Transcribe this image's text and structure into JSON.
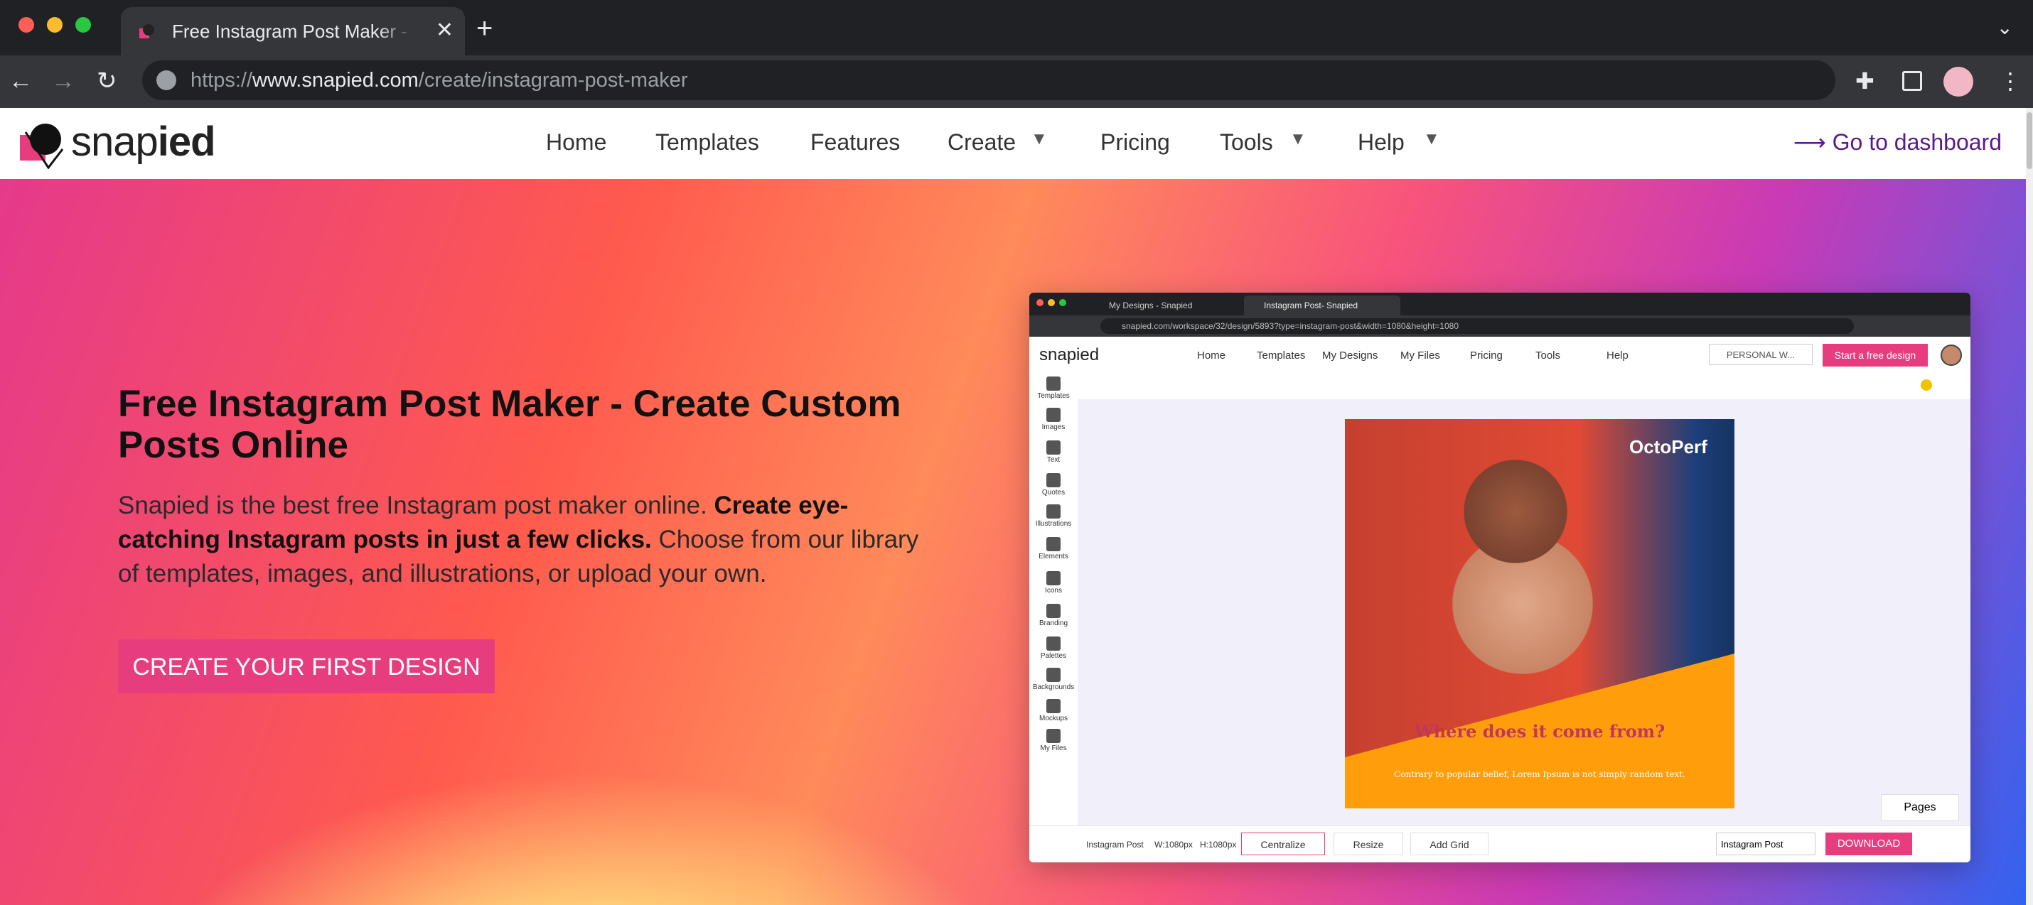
{
  "browser": {
    "tab_title": "Free Instagram Post Maker - Create Custom Posts Online",
    "close_glyph": "✕",
    "new_tab_glyph": "+",
    "url_scheme": "https://",
    "url_host": "www.snapied.com",
    "url_path": "/create/instagram-post-maker"
  },
  "site": {
    "logo_light": "snap",
    "logo_bold": "ied",
    "nav": [
      "Home",
      "Templates",
      "Features",
      "Create",
      "Pricing",
      "Tools",
      "Help"
    ],
    "dashboard": "Go to dashboard"
  },
  "hero": {
    "headline": "Free Instagram Post Maker - Create Custom Posts Online",
    "lead_1": "Snapied is the best free Instagram post maker online. ",
    "lead_strong": "Create eye-catching Instagram posts in just a few clicks.",
    "lead_2": " Choose from our library of templates, images, and illustrations, or upload your own.",
    "cta": "CREATE YOUR FIRST DESIGN"
  },
  "mockup": {
    "tab1": "My Designs - Snapied",
    "tab2": "Instagram Post- Snapied",
    "url": "snapied.com/workspace/32/design/5893?type=instagram-post&width=1080&height=1080",
    "logo": "snapied",
    "nav": [
      "Home",
      "Templates",
      "My Designs",
      "My Files",
      "Pricing",
      "Tools",
      "Help"
    ],
    "personal": "PERSONAL W...",
    "start": "Start a free design",
    "sidebar": [
      "Templates",
      "Images",
      "Text",
      "Quotes",
      "Illustrations",
      "Elements",
      "Icons",
      "Branding",
      "Palettes",
      "Backgrounds",
      "Mockups",
      "My Files"
    ],
    "brand": "OctoPerf",
    "post_title": "Where does it come from?",
    "post_sub": "Contrary to popular belief, Lorem Ipsum is not simply random text.",
    "pages": "Pages",
    "bottom_type": "Instagram Post",
    "bottom_w": "W:1080px",
    "bottom_h": "H:1080px",
    "centralize": "Centralize",
    "resize": "Resize",
    "add_grid": "Add Grid",
    "design_name": "Instagram Post",
    "download": "DOWNLOAD"
  },
  "colors": {
    "accent": "#e73d7f",
    "dashboard": "#5b1a8c"
  }
}
